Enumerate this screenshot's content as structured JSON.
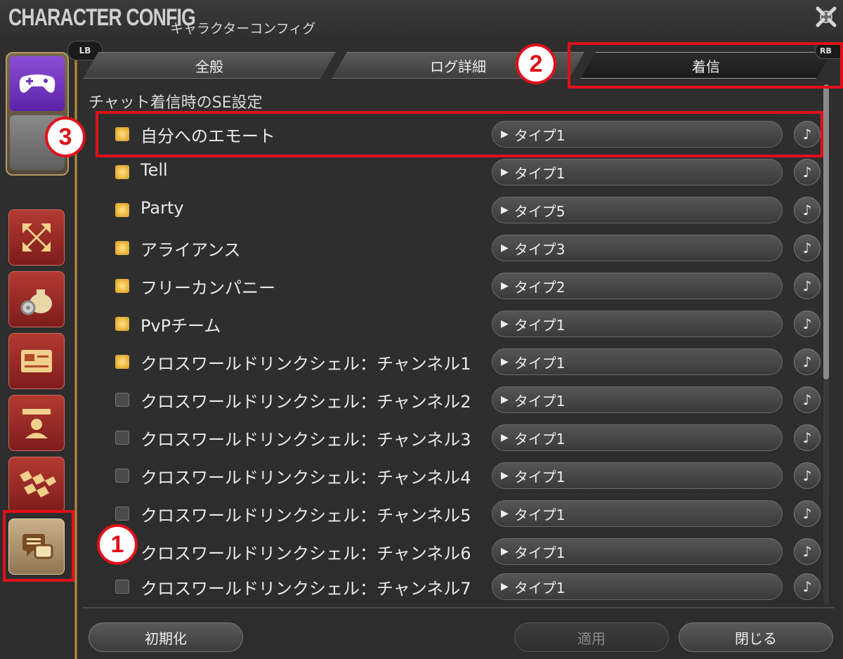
{
  "header": {
    "title_en": "CHARACTER CONFIG",
    "title_jp": "キャラクターコンフィグ"
  },
  "badges": {
    "lb": "LB",
    "rb": "RB"
  },
  "tabs": [
    {
      "label": "全般"
    },
    {
      "label": "ログ詳細"
    },
    {
      "label": "着信"
    }
  ],
  "section_title": "チャット着信時のSE設定",
  "rows": [
    {
      "label": "自分へのエモート",
      "checked": true,
      "type": "タイプ1"
    },
    {
      "label": "Tell",
      "checked": true,
      "type": "タイプ1"
    },
    {
      "label": "Party",
      "checked": true,
      "type": "タイプ5"
    },
    {
      "label": "アライアンス",
      "checked": true,
      "type": "タイプ3"
    },
    {
      "label": "フリーカンパニー",
      "checked": true,
      "type": "タイプ2"
    },
    {
      "label": "PvPチーム",
      "checked": true,
      "type": "タイプ1"
    },
    {
      "label": "クロスワールドリンクシェル：チャンネル1",
      "checked": true,
      "type": "タイプ1"
    },
    {
      "label": "クロスワールドリンクシェル：チャンネル2",
      "checked": false,
      "type": "タイプ1"
    },
    {
      "label": "クロスワールドリンクシェル：チャンネル3",
      "checked": false,
      "type": "タイプ1"
    },
    {
      "label": "クロスワールドリンクシェル：チャンネル4",
      "checked": false,
      "type": "タイプ1"
    },
    {
      "label": "クロスワールドリンクシェル：チャンネル5",
      "checked": false,
      "type": "タイプ1"
    },
    {
      "label": "クロスワールドリンクシェル：チャンネル6",
      "checked": false,
      "type": "タイプ1"
    },
    {
      "label": "クロスワールドリンクシェル：チャンネル7",
      "checked": false,
      "type": "タイプ1"
    }
  ],
  "footer": {
    "reset": "初期化",
    "apply": "適用",
    "close": "閉じる"
  },
  "callouts": {
    "one": "1",
    "two": "2",
    "three": "3"
  },
  "icons": {
    "close": "close-icon",
    "gamepad": "gamepad-icon",
    "play": "note-icon"
  },
  "colors": {
    "highlight": "#e0101a",
    "checkbox_on": "#e0a21c",
    "side_red": "#9a2a25"
  }
}
